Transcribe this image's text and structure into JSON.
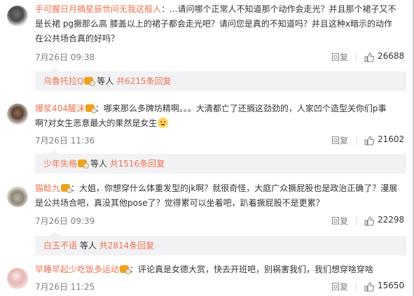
{
  "comments": [
    {
      "username": "手可握日月摘星辰世间无我这般人",
      "text_line1": "：...请问哪个正常人不知道那个动作会走光？并且那个裙子又不",
      "text_line2": "是长裙  pg撅那么高  膝盖以上的裙子都会走光吧？请问您是真的不知道吗？并且这种x暗示的动作",
      "text_line3": "在公共场合真的好吗？",
      "date": "7月26日 09:38",
      "reply_label": "回复",
      "likes": "26688",
      "sub": {
        "username": "乌鲁托拉Q",
        "middle": " 等人 ",
        "count_text": "共6215条回复"
      }
    },
    {
      "username": "爆浆404醒沫",
      "text_line1": "：哪来那么多牌坊精啊。。。大清都亡了还搁这劲劲的，人家凹个造型关你们p事",
      "text_line2": "啊?对女生恶意最大的果然是女生",
      "date": "7月26日 11:36",
      "reply_label": "回复",
      "likes": "21602",
      "sub": {
        "username": "少年失格",
        "middle": " 等人 ",
        "count_text": "共1516条回复"
      }
    },
    {
      "username": "猫鲶九",
      "text_line1": "：大姐，你想穿什么体重发型的jk啊？就很奇怪，大庭广众撅屁股也是政治正确了？漫展",
      "text_line2": "是公共场合吧，真没其他pose了？觉得累可以坐着吧，趴着撅屁股不是更累？",
      "date": "7月26日 09:39",
      "reply_label": "回复",
      "likes": "22298",
      "sub": {
        "username": "白玉不语",
        "middle": " 等人 ",
        "count_text": "共2814条回复"
      }
    },
    {
      "username": "早睡早起少吃饭多运动",
      "text_line1": "：评论真是女德大赏，快去开班吧，别祸害我们，我们想穿啥穿啥",
      "date": "7月26日 11:25",
      "reply_label": "回复",
      "likes": "15650"
    }
  ]
}
